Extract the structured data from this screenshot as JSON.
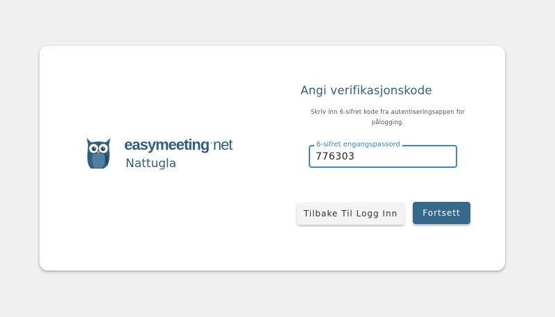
{
  "brand": {
    "logo_icon": "owl-icon",
    "wordmark_main": "easymeeting",
    "wordmark_dot": "·",
    "wordmark_tld": "net",
    "tenant": "Nattugla",
    "color": "#2f5f82"
  },
  "form": {
    "title": "Angi verifikasjonskode",
    "description": "Skriv inn 6-sifret kode fra autentiseringsappen for pålogging.",
    "otp_label": "6-sifret engangspassord",
    "otp_value": "776303",
    "accent_color": "#3b86c4"
  },
  "actions": {
    "back_label": "Tilbake Til Logg Inn",
    "continue_label": "Fortsett",
    "continue_color": "#366a8d"
  }
}
